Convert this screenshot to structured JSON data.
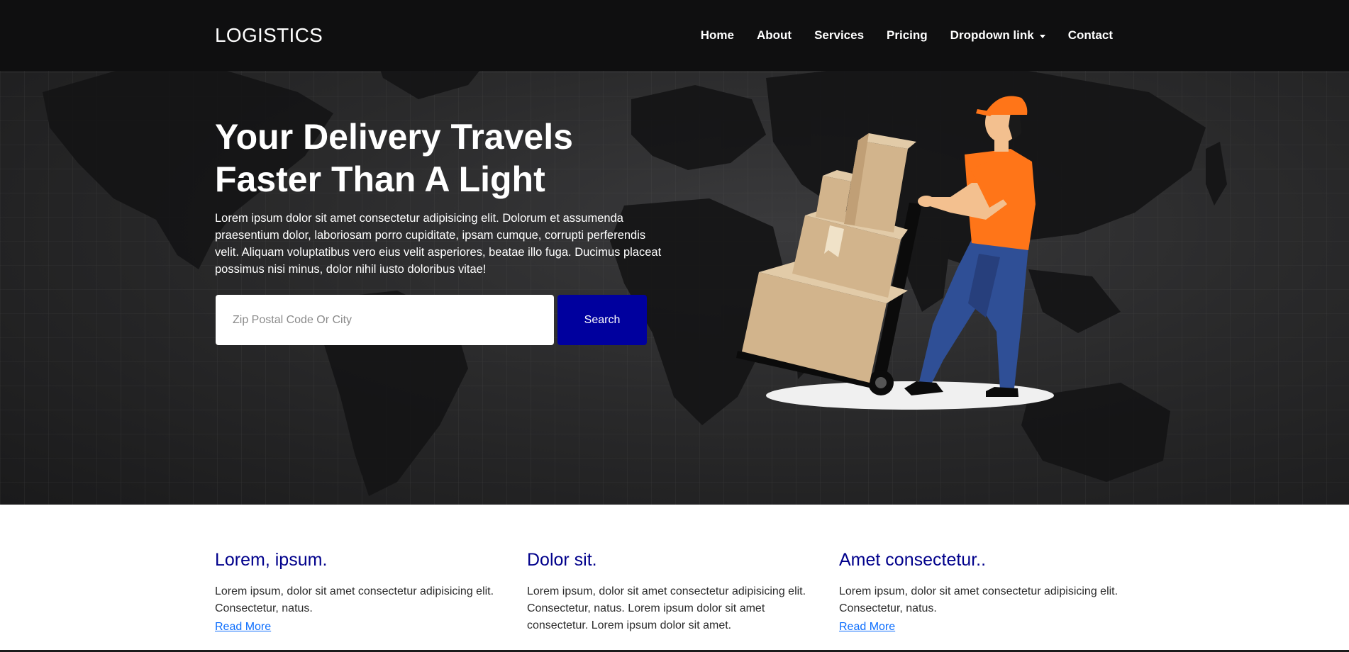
{
  "brand": "LOGISTICS",
  "nav": {
    "items": [
      "Home",
      "About",
      "Services",
      "Pricing",
      "Dropdown link",
      "Contact"
    ]
  },
  "hero": {
    "title_line1": "Your Delivery Travels",
    "title_line2": "Faster Than A Light",
    "text": "Lorem ipsum dolor sit amet consectetur adipisicing elit. Dolorum et assumenda praesentium dolor, laboriosam porro cupiditate, ipsam cumque, corrupti perferendis velit. Aliquam voluptatibus vero eius velit asperiores, beatae illo fuga. Ducimus placeat possimus nisi minus, dolor nihil iusto doloribus vitae!",
    "search_placeholder": "Zip Postal Code Or City",
    "search_button": "Search"
  },
  "features": [
    {
      "title": "Lorem, ipsum.",
      "text": "Lorem ipsum, dolor sit amet consectetur adipisicing elit. Consectetur, natus.",
      "link": "Read More"
    },
    {
      "title": "Dolor sit.",
      "text": "Lorem ipsum, dolor sit amet consectetur adipisicing elit. Consectetur, natus. Lorem ipsum dolor sit amet consectetur. Lorem ipsum dolor sit amet.",
      "link": ""
    },
    {
      "title": "Amet consectetur..",
      "text": "Lorem ipsum, dolor sit amet consectetur adipisicing elit. Consectetur, natus.",
      "link": "Read More"
    }
  ],
  "colors": {
    "navbar_bg": "#0f0f10",
    "hero_bg": "#2a2a2b",
    "accent_button": "#00009e",
    "feature_title": "#00008b",
    "link": "#0d6efd",
    "worker_shirt": "#ff7518",
    "worker_pants": "#2f4f96",
    "box": "#d2b48c"
  },
  "icons": {
    "dropdown": "caret-down-icon",
    "illustration": "delivery-worker-illustration",
    "background": "world-map-background"
  }
}
